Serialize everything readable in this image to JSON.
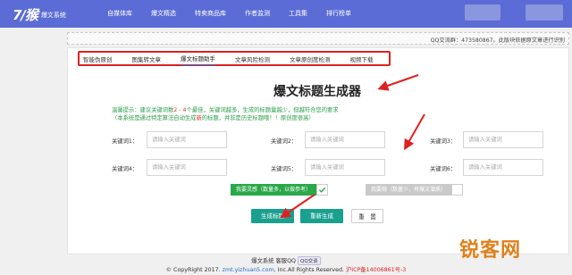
{
  "header": {
    "logo_mark": "7/猴",
    "logo_text": "爆文系统",
    "nav": [
      "自媒体库",
      "爆文精选",
      "特卖商品库",
      "作者监测",
      "工具集",
      "排行榜单"
    ]
  },
  "notice": "QQ交流群：473580867。此版块依据原文章进行识别",
  "tabs": [
    "智能伪原创",
    "图集转文章",
    "爆文标题助手",
    "文章风险检测",
    "文章原创度检测",
    "视频下载"
  ],
  "active_tab_index": 2,
  "main": {
    "title": "爆文标题生成器",
    "tip1_pre": "温馨提示：建议关键词数",
    "tip1_hl": "2 - 4",
    "tip1_post": "个最佳，关键词越多，生成的标题量越少，但越符合您的要求",
    "tip2_pre": "（本系统是通过特定算法自动生成",
    "tip2_hl": "新",
    "tip2_post": "的标题，并非是历史标题哦！！原创度很高）",
    "keywords": [
      {
        "label": "关键词1：",
        "placeholder": "请输入关键词"
      },
      {
        "label": "关键词2：",
        "placeholder": "请输入关键词"
      },
      {
        "label": "关键词3：",
        "placeholder": "请输入关键词"
      },
      {
        "label": "关键词4：",
        "placeholder": "请输入关键词"
      },
      {
        "label": "关键词5：",
        "placeholder": "请输入关键词"
      },
      {
        "label": "关键词6：",
        "placeholder": "请输入关键词"
      }
    ],
    "toggle_left": "我要灵感（数量多，以做参考）",
    "toggle_right": "我要稳（数量少，有爆文潜质）",
    "btn_generate": "生成标题",
    "btn_regenerate": "重新生成",
    "btn_reset": "重　置"
  },
  "footer": {
    "line1": "爆文系统 客服QQ",
    "qq_badge": "QQ交谈",
    "line2_pre": "© CopyRight 2017.",
    "line2_link": "zmt.yizhuan5.com",
    "line2_mid": ", Inc.All Rights Reserved.",
    "line2_icp": "沪ICP备14006861号-3"
  },
  "watermark": "锐客网",
  "colors": {
    "topbar": "#5b6cd6",
    "accent_green": "#1aa08e",
    "tab_outline": "#e02020",
    "tip_green": "#2a9c4a"
  }
}
